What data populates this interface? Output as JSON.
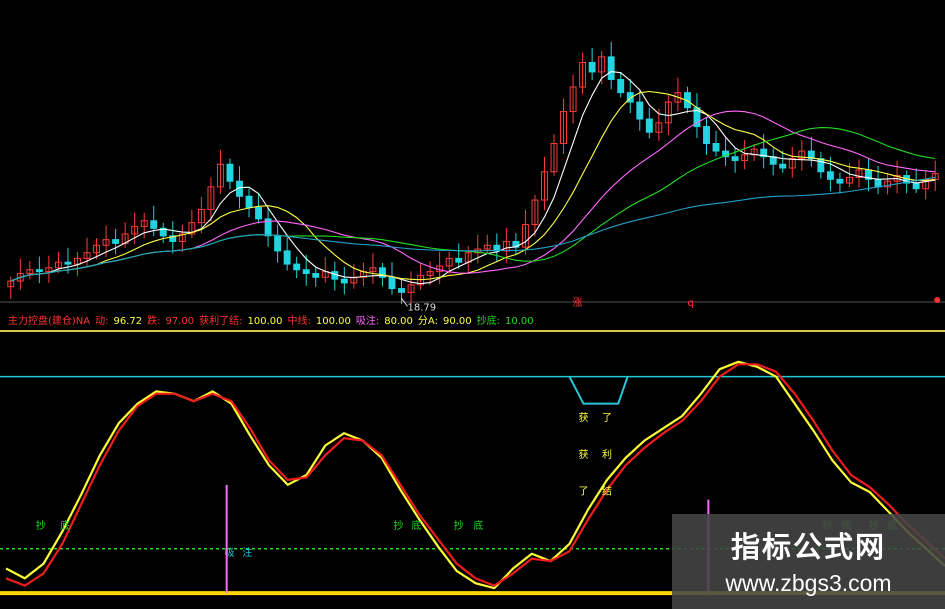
{
  "chart_data": [
    {
      "type": "candlestick",
      "panel": "main",
      "price_range": [
        11.5,
        27.0
      ],
      "low_annotation": "18.79",
      "markers": [
        {
          "x": 0.612,
          "label": "涨",
          "color": "#ff3333"
        },
        {
          "x": 0.733,
          "label": "q",
          "color": "#ff3333"
        },
        {
          "x": 0.997,
          "label": "",
          "color": "#ff3333"
        }
      ],
      "series": [
        {
          "role": "close",
          "values": [
            12.4,
            12.8,
            13.0,
            12.9,
            13.1,
            13.4,
            13.3,
            13.6,
            13.9,
            14.3,
            14.6,
            14.4,
            14.9,
            15.3,
            15.6,
            15.2,
            14.8,
            14.5,
            14.9,
            15.5,
            16.2,
            17.4,
            18.6,
            17.7,
            16.9,
            16.3,
            15.7,
            14.8,
            14.0,
            13.3,
            13.0,
            12.8,
            12.6,
            12.9,
            12.5,
            12.3,
            12.6,
            12.9,
            13.1,
            12.6,
            12.0,
            11.8,
            12.2,
            12.7,
            12.9,
            13.2,
            13.6,
            13.4,
            13.9,
            14.1,
            14.3,
            14.0,
            14.5,
            14.2,
            15.4,
            16.7,
            18.2,
            19.7,
            21.4,
            22.7,
            24.0,
            23.5,
            24.3,
            23.1,
            22.4,
            21.9,
            21.0,
            20.3,
            20.8,
            21.9,
            22.4,
            21.6,
            20.6,
            19.7,
            19.3,
            19.0,
            18.8,
            19.1,
            19.4,
            19.0,
            18.6,
            18.4,
            18.9,
            19.3,
            18.9,
            18.2,
            17.8,
            17.6,
            17.9,
            18.3,
            17.8,
            17.4,
            17.7,
            18.0,
            17.6,
            17.3,
            17.8,
            18.1
          ]
        }
      ],
      "moving_averages": [
        {
          "name": "MA5",
          "color": "#ffffff"
        },
        {
          "name": "MA10",
          "color": "#ffff44"
        },
        {
          "name": "MA20",
          "color": "#ff66ff"
        },
        {
          "name": "MA30",
          "color": "#22dd22"
        },
        {
          "name": "MA60",
          "color": "#22a0c8"
        }
      ]
    },
    {
      "type": "line",
      "panel": "indicator",
      "y_range": [
        0,
        100
      ],
      "legend": [
        {
          "text": "主力控盘(建仓)NA",
          "color": "#ff3333"
        },
        {
          "text": "动:",
          "color": "#ff3333"
        },
        {
          "text": "96.72",
          "color": "#ffff44"
        },
        {
          "text": "跌:",
          "color": "#ff3333"
        },
        {
          "text": "97.00",
          "color": "#ff3333"
        },
        {
          "text": "获利了结:",
          "color": "#ff3333"
        },
        {
          "text": "100.00",
          "color": "#ffff44"
        },
        {
          "text": "中线:",
          "color": "#ff3333"
        },
        {
          "text": "100.00",
          "color": "#ffff44"
        },
        {
          "text": "吸注:",
          "color": "#ff66ff"
        },
        {
          "text": "80.00",
          "color": "#ffff44"
        },
        {
          "text": "分A:",
          "color": "#ffff44"
        },
        {
          "text": "90.00",
          "color": "#ffff44"
        },
        {
          "text": "抄底:",
          "color": "#22dd22"
        },
        {
          "text": "10.00",
          "color": "#22dd22"
        }
      ],
      "x": [
        0.0,
        0.02,
        0.04,
        0.06,
        0.08,
        0.1,
        0.12,
        0.14,
        0.16,
        0.18,
        0.2,
        0.22,
        0.24,
        0.26,
        0.28,
        0.3,
        0.32,
        0.34,
        0.36,
        0.38,
        0.4,
        0.42,
        0.44,
        0.46,
        0.48,
        0.5,
        0.52,
        0.54,
        0.56,
        0.58,
        0.6,
        0.62,
        0.64,
        0.66,
        0.68,
        0.7,
        0.72,
        0.74,
        0.76,
        0.78,
        0.8,
        0.82,
        0.84,
        0.86,
        0.88,
        0.9,
        0.92,
        0.94,
        0.96,
        0.98,
        1.0
      ],
      "series": [
        {
          "name": "",
          "color": "#ffff33",
          "values": [
            12,
            8,
            14,
            27,
            42,
            58,
            71,
            79,
            84,
            83,
            80,
            84,
            79,
            66,
            54,
            46,
            50,
            62,
            67,
            64,
            57,
            44,
            32,
            21,
            11,
            6,
            4,
            12,
            18,
            15,
            22,
            36,
            48,
            57,
            64,
            69,
            74,
            83,
            93,
            96,
            94,
            90,
            79,
            68,
            56,
            47,
            43,
            35,
            27,
            20,
            13
          ]
        },
        {
          "name": "",
          "color": "#ee1c1c",
          "values": [
            8,
            5,
            10,
            22,
            38,
            54,
            68,
            78,
            83,
            83,
            80,
            83,
            80,
            69,
            56,
            48,
            49,
            58,
            65,
            64,
            58,
            46,
            34,
            24,
            14,
            8,
            5,
            10,
            16,
            15,
            19,
            32,
            44,
            54,
            61,
            67,
            72,
            80,
            90,
            95,
            95,
            92,
            83,
            72,
            60,
            50,
            45,
            38,
            30,
            23,
            16
          ]
        }
      ],
      "levels": [
        {
          "value": 90,
          "color": "#22c8d8"
        },
        {
          "value": 20,
          "color": "#22dd22"
        },
        {
          "value": 2,
          "color": "#ffd700"
        }
      ],
      "signals": [
        {
          "type": "label",
          "text": "抄",
          "x": 0.037,
          "y": 28,
          "color": "#22dd22"
        },
        {
          "type": "label",
          "text": "底",
          "x": 0.063,
          "y": 28,
          "color": "#22dd22"
        },
        {
          "type": "label",
          "text": "抄",
          "x": 0.418,
          "y": 28,
          "color": "#22dd22"
        },
        {
          "type": "label",
          "text": "底",
          "x": 0.437,
          "y": 28,
          "color": "#22dd22"
        },
        {
          "type": "label",
          "text": "抄",
          "x": 0.482,
          "y": 28,
          "color": "#22dd22"
        },
        {
          "type": "label",
          "text": "底",
          "x": 0.503,
          "y": 28,
          "color": "#22dd22"
        },
        {
          "type": "label",
          "text": "抄",
          "x": 0.875,
          "y": 28,
          "color": "#22dd22"
        },
        {
          "type": "label",
          "text": "底",
          "x": 0.895,
          "y": 28,
          "color": "#22dd22"
        },
        {
          "type": "label",
          "text": "抄",
          "x": 0.924,
          "y": 28,
          "color": "#22dd22"
        },
        {
          "type": "label",
          "text": "底",
          "x": 0.944,
          "y": 28,
          "color": "#22dd22"
        },
        {
          "type": "label",
          "text": "获",
          "x": 0.615,
          "y": 72,
          "color": "#ffff44"
        },
        {
          "type": "label",
          "text": "了",
          "x": 0.64,
          "y": 72,
          "color": "#ffff44"
        },
        {
          "type": "label",
          "text": "获",
          "x": 0.615,
          "y": 57,
          "color": "#ffff44"
        },
        {
          "type": "label",
          "text": "利",
          "x": 0.64,
          "y": 57,
          "color": "#ffff44"
        },
        {
          "type": "label",
          "text": "了",
          "x": 0.615,
          "y": 42,
          "color": "#ffff44"
        },
        {
          "type": "label",
          "text": "结",
          "x": 0.64,
          "y": 42,
          "color": "#ffff44"
        },
        {
          "type": "label",
          "text": "吸",
          "x": 0.238,
          "y": 17,
          "color": "#22c8d8"
        },
        {
          "type": "label",
          "text": "注",
          "x": 0.257,
          "y": 17,
          "color": "#22c8d8"
        },
        {
          "type": "spike",
          "x": 0.235,
          "from": 2,
          "to": 46,
          "color": "#ff66ff"
        },
        {
          "type": "spike",
          "x": 0.748,
          "from": 2,
          "to": 40,
          "color": "#ff66ff"
        }
      ]
    }
  ],
  "watermark": {
    "title": "指标公式网",
    "url": "www.zbgs3.com"
  }
}
